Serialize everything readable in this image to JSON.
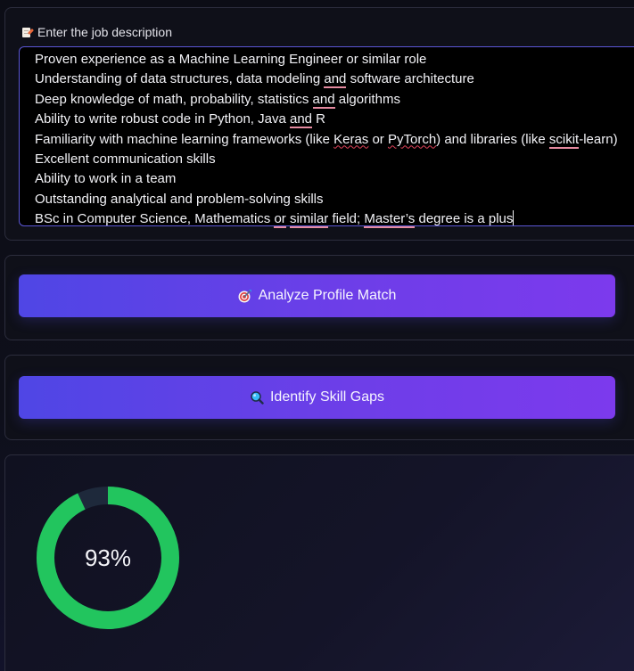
{
  "job_description": {
    "label": "Enter the job description",
    "label_icon": "memo-icon",
    "lines": [
      "Proven experience as a Machine Learning Engineer or similar role",
      "Understanding of data structures, data modeling and software architecture",
      "Deep knowledge of math, probability, statistics and algorithms",
      "Ability to write robust code in Python, Java and R",
      "Familiarity with machine learning frameworks (like Keras or PyTorch) and libraries (like scikit-learn)",
      "Excellent communication skills",
      "Ability to work in a team",
      "Outstanding analytical and problem-solving skills",
      "BSc in Computer Science, Mathematics or similar field; Master’s degree is a plus"
    ],
    "border_color": "#5b57d6"
  },
  "analyze_button": {
    "label": "Analyze Profile Match",
    "icon": "target-icon"
  },
  "skill_gaps_button": {
    "label": "Identify Skill Gaps",
    "icon": "magnifier-icon"
  },
  "match_score": {
    "value": 93,
    "display": "93%",
    "fill_color": "#22c55e",
    "track_color": "#1e293b"
  },
  "colors": {
    "button_gradient_start": "#4f46e5",
    "button_gradient_end": "#7c3aed"
  }
}
